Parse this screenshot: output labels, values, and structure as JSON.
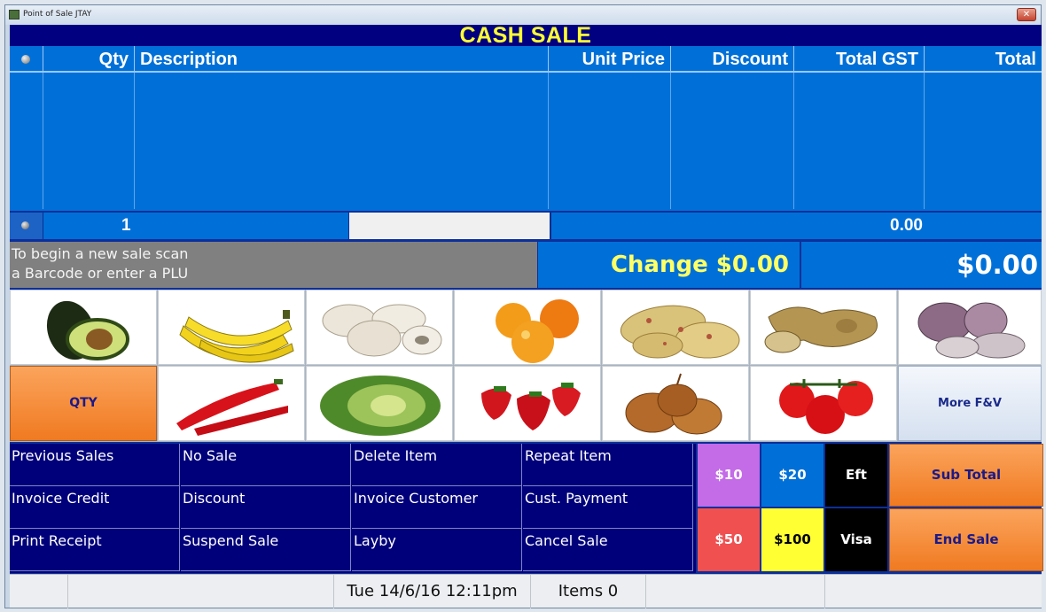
{
  "window": {
    "title": "Point of Sale JTAY",
    "close_glyph": "✕"
  },
  "banner": {
    "title": "CASH SALE"
  },
  "grid": {
    "columns": [
      "Qty",
      "Description",
      "Unit Price",
      "Discount",
      "Total GST",
      "Total"
    ]
  },
  "entry": {
    "qty": "1",
    "amount": "0.00"
  },
  "message": {
    "line1": "To begin a new sale scan",
    "line2": "a Barcode or enter a PLU"
  },
  "change": "Change $0.00",
  "total": "$0.00",
  "produce": {
    "row1": [
      "avocado-icon",
      "banana-icon",
      "mushroom-icon",
      "orange-icon",
      "potato-icon",
      "ginger-icon",
      "garlic-icon"
    ],
    "row2": [
      "chilli-icon",
      "lettuce-icon",
      "strawberry-icon",
      "onion-icon",
      "tomato-icon"
    ],
    "qty_label": "QTY",
    "more_label": "More F&V"
  },
  "functions": [
    [
      "Previous Sales",
      "No Sale",
      "Delete Item",
      "Repeat Item"
    ],
    [
      "Invoice Credit",
      "Discount",
      "Invoice Customer",
      "Cust. Payment"
    ],
    [
      "Print Receipt",
      "Suspend Sale",
      "Layby",
      "Cancel Sale"
    ]
  ],
  "payments": {
    "p10": "$10",
    "p20": "$20",
    "eft": "Eft",
    "p50": "$50",
    "p100": "$100",
    "visa": "Visa",
    "subtotal": "Sub Total",
    "endsale": "End Sale"
  },
  "colors": {
    "p10": "#c46be8",
    "p20": "#0070d8",
    "eft": "#000000",
    "p50": "#f05050",
    "p100": "#ffff33",
    "visa": "#000000"
  },
  "status": {
    "datetime": "Tue 14/6/16 12:11pm",
    "items": "Items 0"
  }
}
